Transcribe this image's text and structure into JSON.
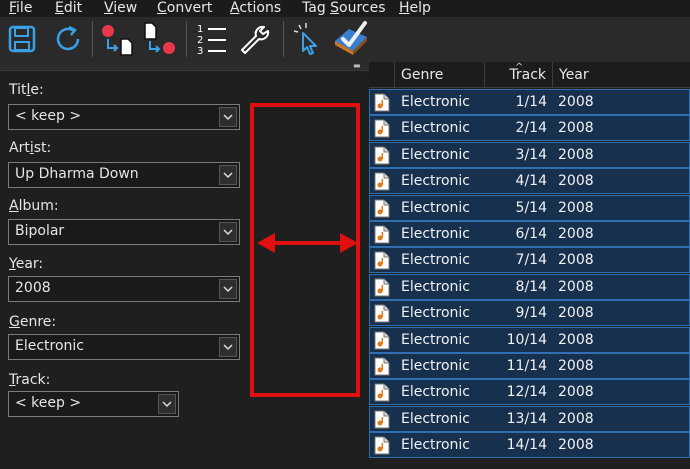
{
  "menu": {
    "file": "File",
    "edit": "Edit",
    "view": "View",
    "convert": "Convert",
    "actions": "Actions",
    "tag_sources": "Tag Sources",
    "help": "Help"
  },
  "fields": {
    "title": {
      "label": "Title:",
      "value": "< keep >"
    },
    "artist": {
      "label": "Artist:",
      "value": "Up Dharma Down"
    },
    "album": {
      "label": "Album:",
      "value": "Bipolar"
    },
    "year": {
      "label": "Year:",
      "value": "2008"
    },
    "genre": {
      "label": "Genre:",
      "value": "Electronic"
    },
    "track": {
      "label": "Track:",
      "value": "< keep >"
    }
  },
  "table": {
    "columns": {
      "genre": "Genre",
      "track": "Track",
      "year": "Year"
    },
    "rows": [
      {
        "genre": "Electronic",
        "track": "1/14",
        "year": "2008"
      },
      {
        "genre": "Electronic",
        "track": "2/14",
        "year": "2008"
      },
      {
        "genre": "Electronic",
        "track": "3/14",
        "year": "2008"
      },
      {
        "genre": "Electronic",
        "track": "4/14",
        "year": "2008"
      },
      {
        "genre": "Electronic",
        "track": "5/14",
        "year": "2008"
      },
      {
        "genre": "Electronic",
        "track": "6/14",
        "year": "2008"
      },
      {
        "genre": "Electronic",
        "track": "7/14",
        "year": "2008"
      },
      {
        "genre": "Electronic",
        "track": "8/14",
        "year": "2008"
      },
      {
        "genre": "Electronic",
        "track": "9/14",
        "year": "2008"
      },
      {
        "genre": "Electronic",
        "track": "10/14",
        "year": "2008"
      },
      {
        "genre": "Electronic",
        "track": "11/14",
        "year": "2008"
      },
      {
        "genre": "Electronic",
        "track": "12/14",
        "year": "2008"
      },
      {
        "genre": "Electronic",
        "track": "13/14",
        "year": "2008"
      },
      {
        "genre": "Electronic",
        "track": "14/14",
        "year": "2008"
      }
    ]
  },
  "icons": [
    "save-icon",
    "refresh-icon",
    "tag-to-filename-icon",
    "filename-to-tag-icon",
    "numbered-list-icon",
    "wrench-icon",
    "select-cursor-icon",
    "tag-check-icon",
    "audio-file-icon",
    "pin-icon",
    "chevron-down-icon"
  ],
  "colors": {
    "accent": "#2f7fd0",
    "selection": "#16304e",
    "annotation": "#e01010",
    "record": "#e8394a"
  }
}
